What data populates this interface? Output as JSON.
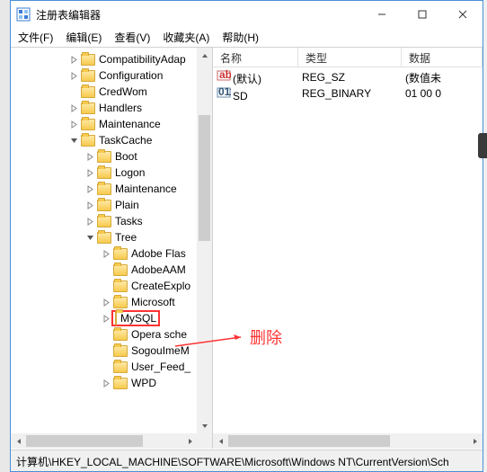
{
  "window": {
    "title": "注册表编辑器"
  },
  "menu": {
    "file": "文件(F)",
    "edit": "编辑(E)",
    "view": "查看(V)",
    "fav": "收藏夹(A)",
    "help": "帮助(H)"
  },
  "tree": [
    {
      "indent": 64,
      "chev": "right",
      "label": "CompatibilityAdap"
    },
    {
      "indent": 64,
      "chev": "right",
      "label": "Configuration"
    },
    {
      "indent": 64,
      "chev": "none",
      "label": "CredWom"
    },
    {
      "indent": 64,
      "chev": "right",
      "label": "Handlers"
    },
    {
      "indent": 64,
      "chev": "right",
      "label": "Maintenance"
    },
    {
      "indent": 64,
      "chev": "down",
      "label": "TaskCache"
    },
    {
      "indent": 82,
      "chev": "right",
      "label": "Boot"
    },
    {
      "indent": 82,
      "chev": "right",
      "label": "Logon"
    },
    {
      "indent": 82,
      "chev": "right",
      "label": "Maintenance"
    },
    {
      "indent": 82,
      "chev": "right",
      "label": "Plain"
    },
    {
      "indent": 82,
      "chev": "right",
      "label": "Tasks"
    },
    {
      "indent": 82,
      "chev": "down",
      "label": "Tree"
    },
    {
      "indent": 100,
      "chev": "right",
      "label": "Adobe Flas"
    },
    {
      "indent": 100,
      "chev": "none",
      "label": "AdobeAAM"
    },
    {
      "indent": 100,
      "chev": "none",
      "label": "CreateExplo"
    },
    {
      "indent": 100,
      "chev": "right",
      "label": "Microsoft"
    },
    {
      "indent": 100,
      "chev": "right",
      "label": "MySQL",
      "highlight": true
    },
    {
      "indent": 100,
      "chev": "none",
      "label": "Opera sche"
    },
    {
      "indent": 100,
      "chev": "none",
      "label": "SogouImeM"
    },
    {
      "indent": 100,
      "chev": "none",
      "label": "User_Feed_"
    },
    {
      "indent": 100,
      "chev": "right",
      "label": "WPD"
    }
  ],
  "list": {
    "headers": {
      "name": "名称",
      "type": "类型",
      "data": "数据"
    },
    "rows": [
      {
        "icon": "str",
        "name": "(默认)",
        "type": "REG_SZ",
        "data": "(数值未"
      },
      {
        "icon": "bin",
        "name": "SD",
        "type": "REG_BINARY",
        "data": "01 00 0"
      }
    ]
  },
  "annotation": {
    "text": "删除"
  },
  "statusbar": "计算机\\HKEY_LOCAL_MACHINE\\SOFTWARE\\Microsoft\\Windows NT\\CurrentVersion\\Sch"
}
